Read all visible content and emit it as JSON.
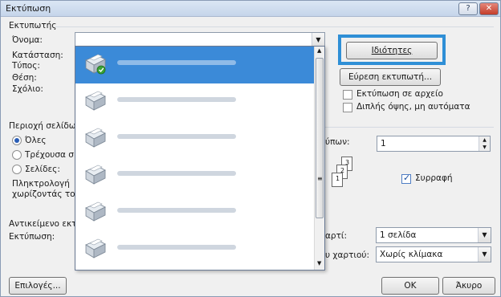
{
  "window": {
    "title": "Εκτύπωση",
    "help_glyph": "?",
    "close_glyph": "✕"
  },
  "printer": {
    "section_label": "Εκτυπωτής",
    "name_label": "Όνομα:",
    "status_label": "Κατάσταση:",
    "type_label": "Τύπος:",
    "where_label": "Θέση:",
    "comment_label": "Σχόλιο:",
    "properties_button": "Ιδιότητες",
    "find_printer_button": "Εύρεση εκτυπωτή...",
    "print_to_file_label": "Εκτύπωση σε αρχείο",
    "manual_duplex_label": "Διπλής όψης, μη αυτόματα",
    "print_to_file_checked": false,
    "manual_duplex_checked": false
  },
  "page_range": {
    "section_label": "Περιοχή σελίδω",
    "all_label": "Όλες",
    "current_label": "Τρέχουσα σ",
    "pages_label": "Σελίδες:",
    "hint_line1": "Πληκτρολογή",
    "hint_line2": "χωρίζοντάς το",
    "selected": "all"
  },
  "copies": {
    "label": "ύπων:",
    "value": "1",
    "collate_label": "Συρραφή",
    "collate_checked": true
  },
  "print_what_label": "Αντικείμενο εκτύ",
  "print_label": "Εκτύπωση:",
  "zoom": {
    "pages_per_sheet_label": "αρτί:",
    "pages_per_sheet_value": "1 σελίδα",
    "scale_label": "υ χαρτιού:",
    "scale_value": "Χωρίς κλίμακα"
  },
  "footer": {
    "options_button": "Επιλογές...",
    "ok_button": "OK",
    "cancel_button": "Άκυρο"
  },
  "printer_list_count": 6,
  "accent_color": "#2f8fd6"
}
